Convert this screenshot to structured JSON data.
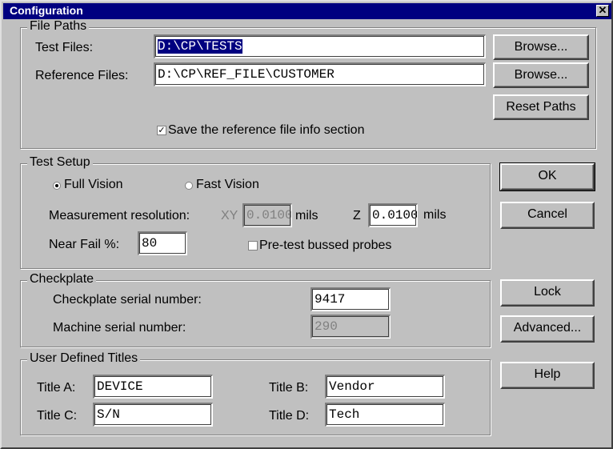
{
  "window": {
    "title": "Configuration",
    "close_glyph": "✕"
  },
  "file_paths": {
    "legend": "File Paths",
    "test_label": "Test Files:",
    "test_value": "D:\\CP\\TESTS",
    "ref_label": "Reference Files:",
    "ref_value": "D:\\CP\\REF_FILE\\CUSTOMER",
    "browse1_label": "Browse...",
    "browse2_label": "Browse...",
    "reset_label": "Reset Paths",
    "save_ref_label": "Save the reference file info section",
    "save_ref_checked": true
  },
  "test_setup": {
    "legend": "Test Setup",
    "full_vision": "Full Vision",
    "fast_vision": "Fast Vision",
    "selected": "Full Vision",
    "measure_label": "Measurement resolution:",
    "xy_label": "XY",
    "xy_value": "0.0100",
    "mils1": "mils",
    "z_label": "Z",
    "z_value": "0.0100",
    "mils2": "mils",
    "near_fail_label": "Near Fail %:",
    "near_fail_value": "80",
    "pretest_label": "Pre-test bussed probes",
    "pretest_checked": false
  },
  "checkplate": {
    "legend": "Checkplate",
    "serial_label": "Checkplate serial number:",
    "serial_value": "9417",
    "machine_label": "Machine serial number:",
    "machine_value": "290"
  },
  "titles": {
    "legend": "User Defined Titles",
    "a_label": "Title A:",
    "a_value": "DEVICE",
    "b_label": "Title B:",
    "b_value": "Vendor",
    "c_label": "Title C:",
    "c_value": "S/N",
    "d_label": "Title D:",
    "d_value": "Tech"
  },
  "buttons": {
    "ok": "OK",
    "cancel": "Cancel",
    "lock": "Lock",
    "advanced": "Advanced...",
    "help": "Help"
  },
  "colors": {
    "titlebar": "#000080",
    "face": "#c0c0c0"
  }
}
